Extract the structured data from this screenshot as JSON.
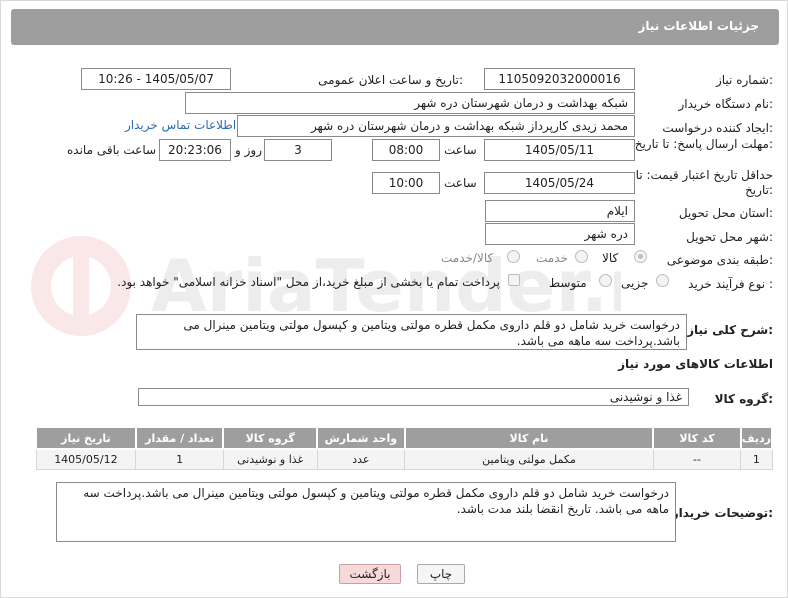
{
  "page": {
    "title": "جزئیات اطلاعات نیاز"
  },
  "fields": {
    "need_number_label": "شماره نیاز:",
    "need_number": "1105092032000016",
    "announce_label": "تاریخ و ساعت اعلان عمومی:",
    "announce_value": "1405/05/07 - 10:26",
    "buyer_org_label": "نام دستگاه خریدار:",
    "buyer_org": "شبکه بهداشت و درمان شهرستان دره شهر",
    "requester_label": "ایجاد کننده درخواست:",
    "requester": "محمد زیدی کارپرداز شبکه بهداشت و درمان شهرستان دره شهر",
    "contact_link": "اطلاعات تماس خریدار",
    "reply_deadline_label": "مهلت ارسال پاسخ: تا تاریخ:",
    "reply_date": "1405/05/11",
    "time_label": "ساعت",
    "reply_time": "08:00",
    "days_value": "3",
    "days_label": "روز و",
    "remaining_time": "20:23:06",
    "remaining_label": "ساعت باقی مانده",
    "price_deadline_label": "حداقل تاریخ اعتبار قیمت: تا تاریخ:",
    "price_date": "1405/05/24",
    "price_time": "10:00",
    "province_label": "استان محل تحویل:",
    "province": "ایلام",
    "city_label": "شهر محل تحویل:",
    "city": "دره شهر",
    "category_label": "طبقه بندی موضوعی:",
    "category_options": [
      "کالا",
      "خدمت",
      "کالا/خدمت"
    ],
    "process_label": "نوع فرآیند خرید :",
    "process_options": [
      "جزیی",
      "متوسط"
    ],
    "payment_note": "پرداخت تمام یا بخشی از مبلغ خرید،از محل \"اسناد خزانه اسلامی\" خواهد بود.",
    "summary_label": "شرح کلی نیاز:",
    "summary": "درخواست خرید شامل دو قلم داروی مکمل قطره مولتی ویتامین و کپسول مولتی ویتامین مینرال می باشد.پرداخت سه ماهه می باشد.",
    "goods_info_title": "اطلاعات کالاهای مورد نیاز",
    "goods_group_label": "گروه کالا:",
    "goods_group": "غذا و نوشیدنی",
    "buyer_notes_label": "توضیحات خریدار:",
    "buyer_notes": "درخواست خرید شامل دو قلم داروی مکمل قطره مولتی ویتامین و کپسول مولتی ویتامین مینرال می باشد.پرداخت سه ماهه می باشد. تاریخ انقضا بلند مدت باشد."
  },
  "table": {
    "headers": [
      "ردیف",
      "کد کالا",
      "نام کالا",
      "واحد شمارش",
      "گروه کالا",
      "تعداد / مقدار",
      "تاریخ نیاز"
    ],
    "rows": [
      [
        "1",
        "--",
        "مکمل مولتی ویتامین",
        "عدد",
        "غذا و نوشیدنی",
        "1",
        "1405/05/12"
      ]
    ]
  },
  "buttons": {
    "print": "چاپ",
    "back": "بازگشت"
  },
  "watermark": "AriaTender.neT",
  "colors": {
    "header_bg": "#9e9e9e",
    "link": "#2a6db5",
    "back_button_bg": "#f7d9d9"
  }
}
